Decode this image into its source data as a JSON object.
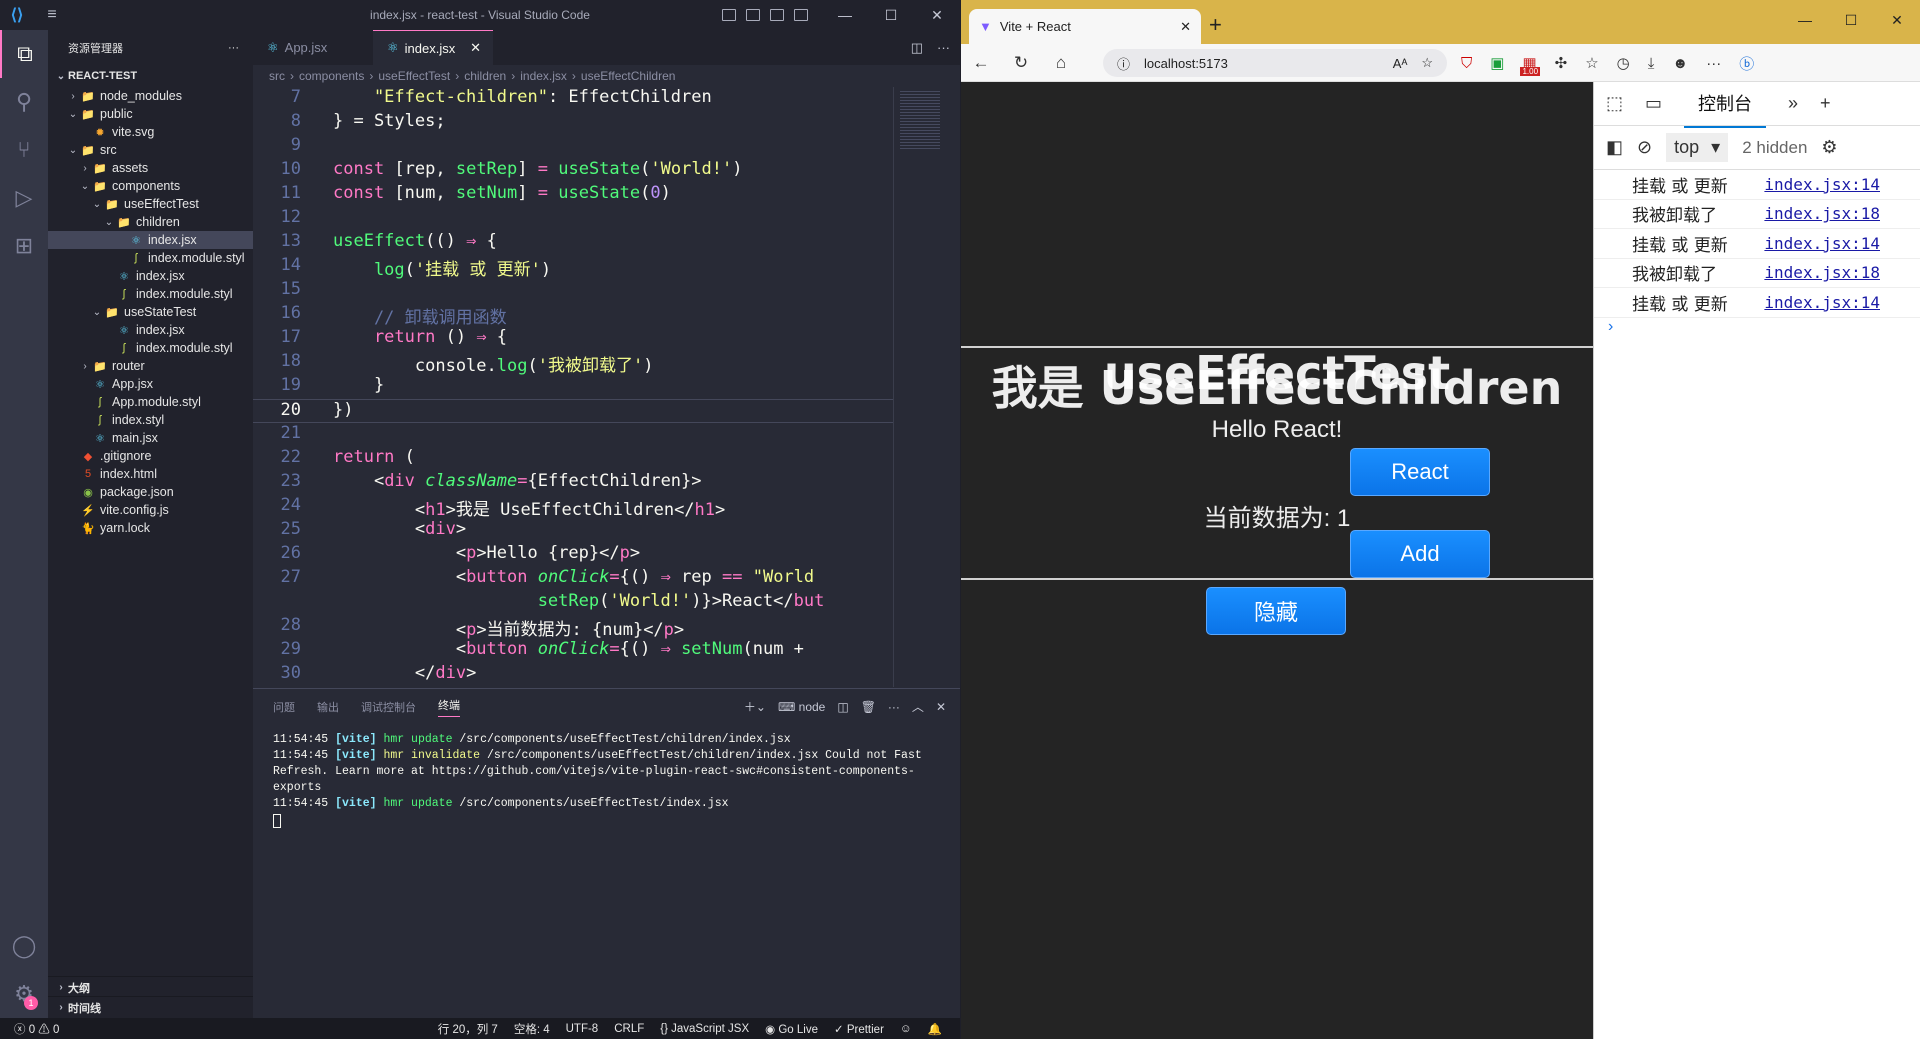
{
  "vscode": {
    "title": "index.jsx - react-test - Visual Studio Code",
    "explorer_title": "资源管理器",
    "root": "REACT-TEST",
    "tree": [
      {
        "label": "node_modules",
        "depth": 1,
        "kind": "folder",
        "open": false
      },
      {
        "label": "public",
        "depth": 1,
        "kind": "folder",
        "open": true
      },
      {
        "label": "vite.svg",
        "depth": 2,
        "kind": "svg"
      },
      {
        "label": "src",
        "depth": 1,
        "kind": "folder",
        "open": true
      },
      {
        "label": "assets",
        "depth": 2,
        "kind": "folder",
        "open": false
      },
      {
        "label": "components",
        "depth": 2,
        "kind": "folder",
        "open": true
      },
      {
        "label": "useEffectTest",
        "depth": 3,
        "kind": "folder",
        "open": true
      },
      {
        "label": "children",
        "depth": 4,
        "kind": "folder",
        "open": true
      },
      {
        "label": "index.jsx",
        "depth": 5,
        "kind": "jsx",
        "selected": true
      },
      {
        "label": "index.module.styl",
        "depth": 5,
        "kind": "styl"
      },
      {
        "label": "index.jsx",
        "depth": 4,
        "kind": "jsx"
      },
      {
        "label": "index.module.styl",
        "depth": 4,
        "kind": "styl"
      },
      {
        "label": "useStateTest",
        "depth": 3,
        "kind": "folder",
        "open": true
      },
      {
        "label": "index.jsx",
        "depth": 4,
        "kind": "jsx"
      },
      {
        "label": "index.module.styl",
        "depth": 4,
        "kind": "styl"
      },
      {
        "label": "router",
        "depth": 2,
        "kind": "folder",
        "open": false
      },
      {
        "label": "App.jsx",
        "depth": 2,
        "kind": "jsx"
      },
      {
        "label": "App.module.styl",
        "depth": 2,
        "kind": "styl"
      },
      {
        "label": "index.styl",
        "depth": 2,
        "kind": "styl"
      },
      {
        "label": "main.jsx",
        "depth": 2,
        "kind": "jsx"
      },
      {
        "label": ".gitignore",
        "depth": 1,
        "kind": "git"
      },
      {
        "label": "index.html",
        "depth": 1,
        "kind": "html"
      },
      {
        "label": "package.json",
        "depth": 1,
        "kind": "json"
      },
      {
        "label": "vite.config.js",
        "depth": 1,
        "kind": "js"
      },
      {
        "label": "yarn.lock",
        "depth": 1,
        "kind": "yarn"
      }
    ],
    "outline": "大纲",
    "timeline": "时间线",
    "tabs": [
      {
        "label": "App.jsx"
      },
      {
        "label": "index.jsx",
        "active": true
      }
    ],
    "breadcrumbs": [
      "src",
      "components",
      "useEffectTest",
      "children",
      "index.jsx",
      "useEffectChildren"
    ],
    "code_lines": [
      {
        "n": "7",
        "html": "<span class='s'>    \"Effect-children\"</span><span class='v'>: EffectChildren</span>"
      },
      {
        "n": "8",
        "html": "<span class='v'>} = Styles;</span>"
      },
      {
        "n": "9",
        "html": ""
      },
      {
        "n": "10",
        "html": "<span class='k'>const</span><span class='v'> [rep, </span><span class='f'>setRep</span><span class='v'>] </span><span class='k'>=</span><span class='f'> useState</span><span class='v'>(</span><span class='s'>'World!'</span><span class='v'>)</span>"
      },
      {
        "n": "11",
        "html": "<span class='k'>const</span><span class='v'> [num, </span><span class='f'>setNum</span><span class='v'>] </span><span class='k'>=</span><span class='f'> useState</span><span class='v'>(</span><span class='n'>0</span><span class='v'>)</span>"
      },
      {
        "n": "12",
        "html": ""
      },
      {
        "n": "13",
        "html": "<span class='f'>useEffect</span><span class='v'>(() </span><span class='k'>⇒</span><span class='v'> {</span>"
      },
      {
        "n": "14",
        "html": "<span class='f'>    log</span><span class='v'>(</span><span class='s'>'挂载 或 更新'</span><span class='v'>)</span>"
      },
      {
        "n": "15",
        "html": ""
      },
      {
        "n": "16",
        "html": "<span class='c'>    // 卸载调用函数</span>"
      },
      {
        "n": "17",
        "html": "<span class='k'>    return</span><span class='v'> () </span><span class='k'>⇒</span><span class='v'> {</span>"
      },
      {
        "n": "18",
        "html": "<span class='v'>        console.</span><span class='f'>log</span><span class='v'>(</span><span class='s'>'我被卸载了'</span><span class='v'>)</span>"
      },
      {
        "n": "19",
        "html": "<span class='v'>    }</span>"
      },
      {
        "n": "20",
        "html": "<span class='v'>})</span>",
        "current": true
      },
      {
        "n": "21",
        "html": ""
      },
      {
        "n": "22",
        "html": "<span class='k'>return</span><span class='v'> (</span>"
      },
      {
        "n": "23",
        "html": "<span class='v'>    &lt;</span><span class='t'>div</span><span class='a'> className</span><span class='k'>=</span><span class='v'>{EffectChildren}&gt;</span>"
      },
      {
        "n": "24",
        "html": "<span class='v'>        &lt;</span><span class='t'>h1</span><span class='v'>&gt;我是 UseEffectChildren&lt;/</span><span class='t'>h1</span><span class='v'>&gt;</span>"
      },
      {
        "n": "25",
        "html": "<span class='v'>        &lt;</span><span class='t'>div</span><span class='v'>&gt;</span>"
      },
      {
        "n": "26",
        "html": "<span class='v'>            &lt;</span><span class='t'>p</span><span class='v'>&gt;Hello {rep}&lt;/</span><span class='t'>p</span><span class='v'>&gt;</span>"
      },
      {
        "n": "27",
        "html": "<span class='v'>            &lt;</span><span class='t'>button</span><span class='a'> onClick</span><span class='k'>=</span><span class='v'>{() </span><span class='k'>⇒</span><span class='v'> rep </span><span class='k'>==</span><span class='s'> \"World</span>"
      },
      {
        "n": "",
        "html": "<span class='f'>                    setRep</span><span class='v'>(</span><span class='s'>'World!'</span><span class='v'>)}&gt;React&lt;/</span><span class='t'>but</span>"
      },
      {
        "n": "28",
        "html": "<span class='v'>            &lt;</span><span class='t'>p</span><span class='v'>&gt;当前数据为: {num}&lt;/</span><span class='t'>p</span><span class='v'>&gt;</span>"
      },
      {
        "n": "29",
        "html": "<span class='v'>            &lt;</span><span class='t'>button</span><span class='a'> onClick</span><span class='k'>=</span><span class='v'>{() </span><span class='k'>⇒</span><span class='f'> setNum</span><span class='v'>(num +</span>"
      },
      {
        "n": "30",
        "html": "<span class='v'>        &lt;/</span><span class='t'>div</span><span class='v'>&gt;</span>"
      }
    ],
    "panel_tabs": [
      "问题",
      "输出",
      "调试控制台",
      "终端"
    ],
    "panel_active": "终端",
    "terminal_shell": "node",
    "terminal_lines": [
      {
        "time": "11:54:45",
        "tag": "[vite]",
        "kind": "hmr update",
        "text": " /src/components/useEffectTest/children/index.jsx"
      },
      {
        "time": "11:54:45",
        "tag": "[vite]",
        "kind": "hmr invalidate",
        "text": " /src/components/useEffectTest/children/index.jsx Could not Fast Refresh. Learn more at https://github.com/vitejs/vite-plugin-react-swc#consistent-components-exports"
      },
      {
        "time": "11:54:45",
        "tag": "[vite]",
        "kind": "hmr update",
        "text": " /src/components/useEffectTest/index.jsx"
      }
    ],
    "status": {
      "errors": "0",
      "warnings": "0",
      "position": "行 20，列 7",
      "spaces": "空格: 4",
      "encoding": "UTF-8",
      "eol": "CRLF",
      "language": "JavaScript JSX",
      "golive": "Go Live",
      "prettier": "Prettier"
    }
  },
  "browser": {
    "tab_title": "Vite + React",
    "url": "localhost:5173",
    "zoom_badge": "1.00",
    "page": {
      "heading": "useEffectTest",
      "child_heading": "我是 UseEffectChildren",
      "hello": "Hello React!",
      "react_button": "React",
      "count_text": "当前数据为: 1",
      "add_button": "Add",
      "hide_button": "隐藏"
    },
    "devtools": {
      "console_tab": "控制台",
      "context": "top",
      "hidden": "2 hidden",
      "messages": [
        {
          "text": "挂载 或 更新",
          "source": "index.jsx:14"
        },
        {
          "text": "我被卸载了",
          "source": "index.jsx:18"
        },
        {
          "text": "挂载 或 更新",
          "source": "index.jsx:14"
        },
        {
          "text": "我被卸载了",
          "source": "index.jsx:18"
        },
        {
          "text": "挂载 或 更新",
          "source": "index.jsx:14"
        }
      ]
    }
  }
}
